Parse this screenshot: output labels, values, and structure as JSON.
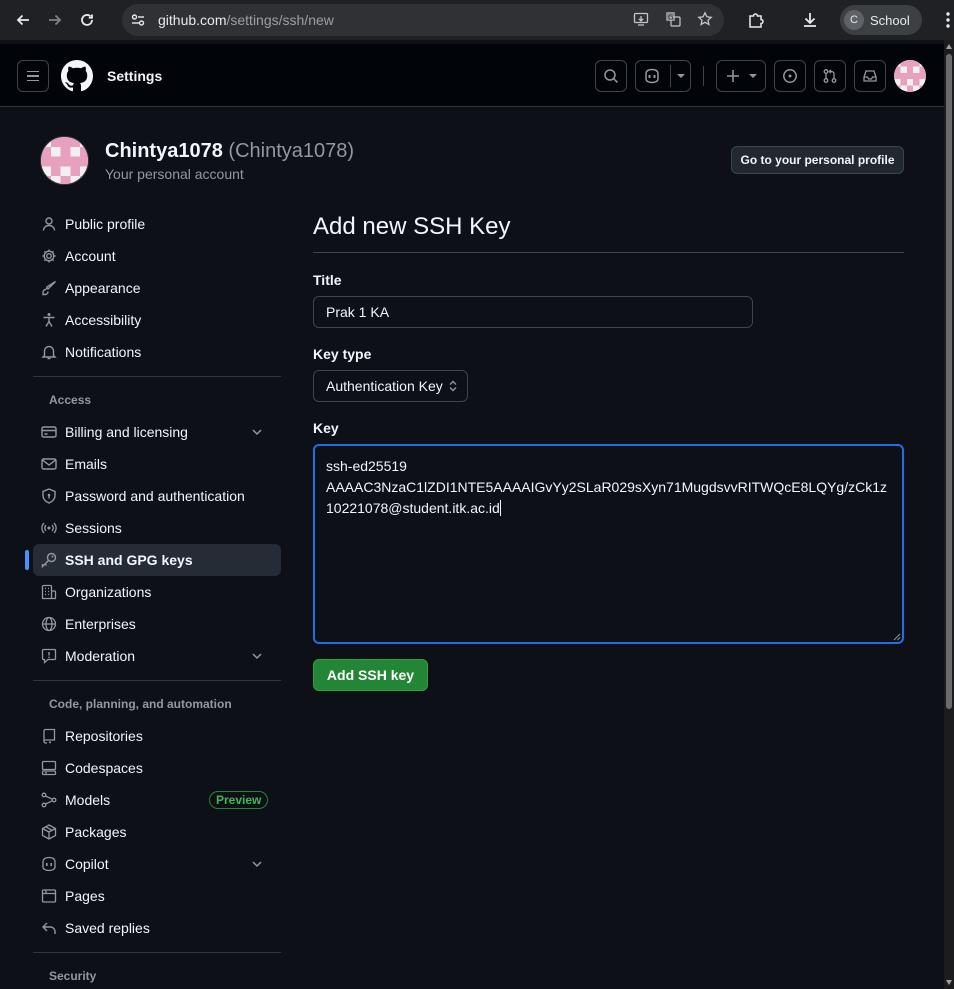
{
  "browser": {
    "url_host": "github.com",
    "url_path": "/settings/ssh/new",
    "profile_initial": "C",
    "profile_name": "School",
    "icons": [
      "back-icon",
      "forward-icon",
      "reload-icon",
      "site-info-icon",
      "install-app-icon",
      "translate-icon",
      "bookmark-star-icon",
      "extensions-icon",
      "downloads-icon",
      "more-menu-icon"
    ]
  },
  "header": {
    "title": "Settings",
    "icons": [
      "menu-icon",
      "github-logo-icon",
      "search-icon",
      "copilot-icon",
      "chevron-down-icon",
      "plus-icon",
      "issues-icon",
      "pull-requests-icon",
      "inbox-icon"
    ]
  },
  "account": {
    "display_name": "Chintya1078",
    "login": "(Chintya1078)",
    "subtitle": "Your personal account",
    "profile_button": "Go to your personal profile"
  },
  "sidebar": {
    "items": [
      {
        "label": "Public profile",
        "icon": "person-icon"
      },
      {
        "label": "Account",
        "icon": "gear-icon"
      },
      {
        "label": "Appearance",
        "icon": "paintbrush-icon"
      },
      {
        "label": "Accessibility",
        "icon": "accessibility-icon"
      },
      {
        "label": "Notifications",
        "icon": "bell-icon"
      }
    ],
    "access_heading": "Access",
    "access_items": [
      {
        "label": "Billing and licensing",
        "icon": "credit-card-icon",
        "expandable": true
      },
      {
        "label": "Emails",
        "icon": "mail-icon"
      },
      {
        "label": "Password and authentication",
        "icon": "shield-lock-icon"
      },
      {
        "label": "Sessions",
        "icon": "broadcast-icon"
      },
      {
        "label": "SSH and GPG keys",
        "icon": "key-icon",
        "active": true
      },
      {
        "label": "Organizations",
        "icon": "organization-icon"
      },
      {
        "label": "Enterprises",
        "icon": "globe-icon"
      },
      {
        "label": "Moderation",
        "icon": "report-icon",
        "expandable": true
      }
    ],
    "code_heading": "Code, planning, and automation",
    "code_items": [
      {
        "label": "Repositories",
        "icon": "repo-icon"
      },
      {
        "label": "Codespaces",
        "icon": "codespaces-icon"
      },
      {
        "label": "Models",
        "icon": "models-icon",
        "badge": "Preview"
      },
      {
        "label": "Packages",
        "icon": "package-icon"
      },
      {
        "label": "Copilot",
        "icon": "copilot-icon",
        "expandable": true
      },
      {
        "label": "Pages",
        "icon": "browser-icon"
      },
      {
        "label": "Saved replies",
        "icon": "reply-icon"
      }
    ],
    "security_heading": "Security"
  },
  "form": {
    "heading": "Add new SSH Key",
    "title_label": "Title",
    "title_value": "Prak 1 KA",
    "key_type_label": "Key type",
    "key_type_value": "Authentication Key",
    "key_label": "Key",
    "key_lines": [
      "ssh-ed25519",
      "AAAAC3NzaC1lZDI1NTE5AAAAIGvYy2SLaR029sXyn71MugdsvvRITWQcE8LQYg/zCk1z",
      "10221078@student.itk.ac.id"
    ],
    "submit_label": "Add SSH key"
  },
  "colors": {
    "page_bg": "#0d1117",
    "header_bg": "#010409",
    "accent_blue": "#4493f8",
    "success_green": "#238636",
    "avatar_pink": "#e8a0bf"
  }
}
